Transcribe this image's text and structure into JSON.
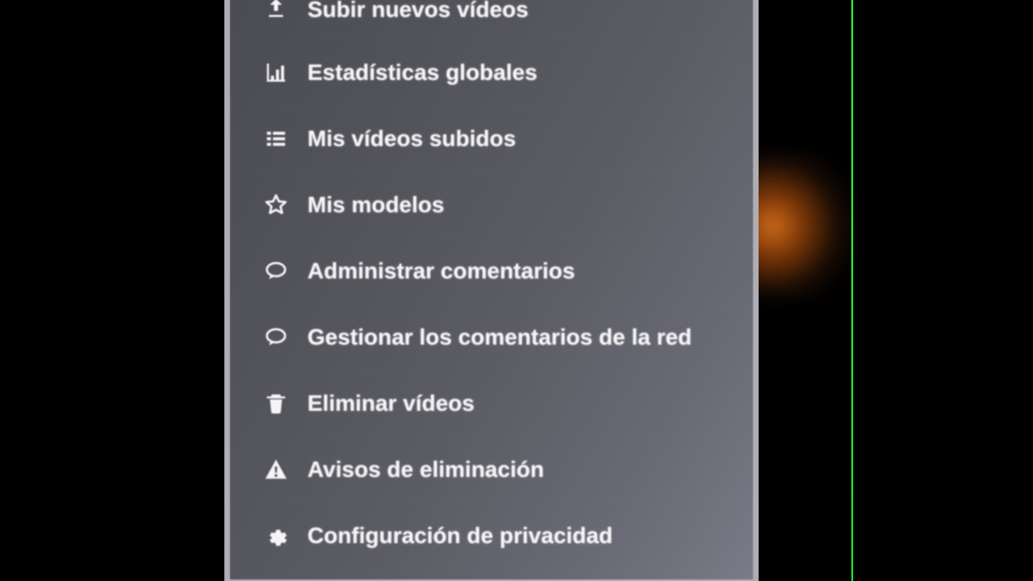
{
  "menu": {
    "items": [
      {
        "label": "Subir nuevos vídeos",
        "icon": "upload-icon"
      },
      {
        "label": "Estadísticas globales",
        "icon": "bar-chart-icon"
      },
      {
        "label": "Mis vídeos subidos",
        "icon": "list-icon"
      },
      {
        "label": "Mis modelos",
        "icon": "star-icon"
      },
      {
        "label": "Administrar comentarios",
        "icon": "comment-icon"
      },
      {
        "label": "Gestionar los comentarios de la red",
        "icon": "comment-icon"
      },
      {
        "label": "Eliminar vídeos",
        "icon": "trash-icon"
      },
      {
        "label": "Avisos de eliminación",
        "icon": "warning-icon"
      },
      {
        "label": "Configuración de privacidad",
        "icon": "gear-icon"
      }
    ]
  }
}
